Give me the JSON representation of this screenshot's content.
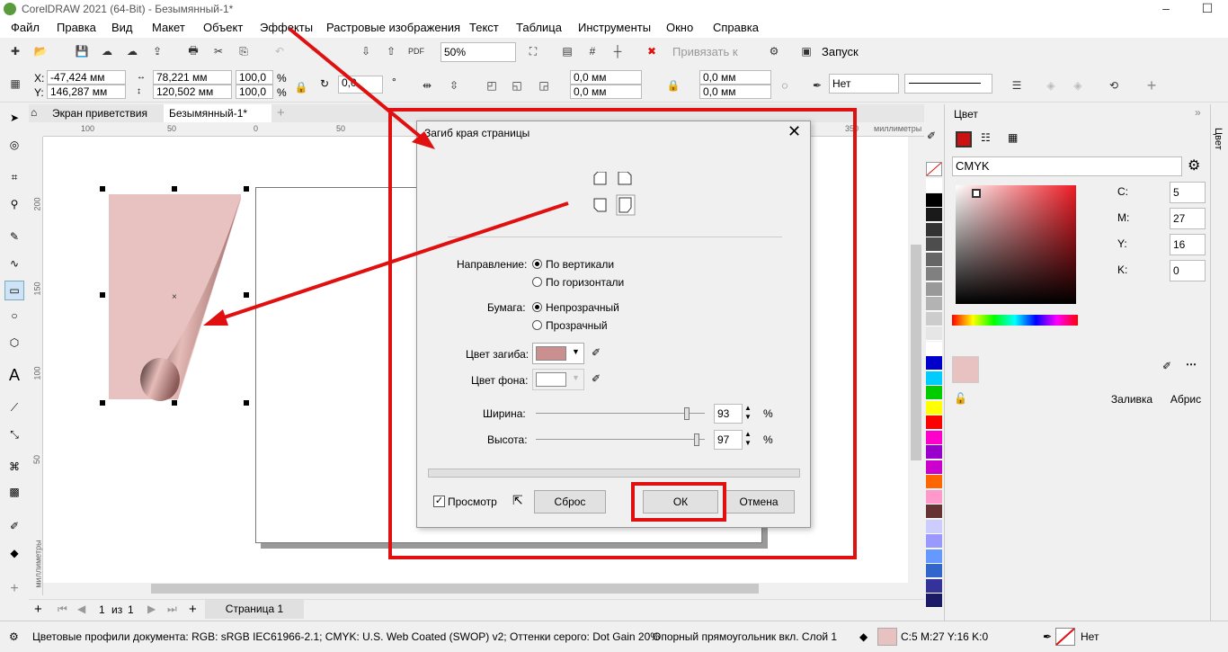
{
  "app": {
    "title": "CorelDRAW 2021 (64-Bit) - Безымянный-1*"
  },
  "menu": [
    "Файл",
    "Правка",
    "Вид",
    "Макет",
    "Объект",
    "Эффекты",
    "Растровые изображения",
    "Текст",
    "Таблица",
    "Инструменты",
    "Окно",
    "Справка"
  ],
  "toolbar": {
    "zoom": "50%",
    "snap_label": "Привязать к",
    "launch_label": "Запуск"
  },
  "props": {
    "x": "-47,424 мм",
    "y": "146,287 мм",
    "w": "78,221 мм",
    "h": "120,502 мм",
    "sx": "100,0",
    "sy": "100,0",
    "pct": "%",
    "rotation": "0,0",
    "deg": "°",
    "r1": "0,0 мм",
    "r2": "0,0 мм",
    "r3": "0,0 мм",
    "r4": "0,0 мм",
    "outline": "Нет"
  },
  "tabs": {
    "welcome": "Экран приветствия",
    "doc": "Безымянный-1*"
  },
  "ruler": {
    "h": [
      "100",
      "50",
      "0",
      "50",
      "350"
    ],
    "unit": "миллиметры",
    "v": [
      "200",
      "150",
      "100",
      "50"
    ],
    "vunit": "миллиметры"
  },
  "pages": {
    "current": "1",
    "of": "из",
    "total": "1",
    "page_tab": "Страница 1"
  },
  "dialog": {
    "title": "Загиб края страницы",
    "direction_label": "Направление:",
    "dir_vertical": "По вертикали",
    "dir_horizontal": "По горизонтали",
    "paper_label": "Бумага:",
    "paper_opaque": "Непрозрачный",
    "paper_transparent": "Прозрачный",
    "curl_color_label": "Цвет загиба:",
    "bg_color_label": "Цвет фона:",
    "width_label": "Ширина:",
    "width_value": "93",
    "height_label": "Высота:",
    "height_value": "97",
    "pct": "%",
    "preview_label": "Просмотр",
    "reset_label": "Сброс",
    "ok_label": "ОК",
    "cancel_label": "Отмена",
    "width_frac": 0.93,
    "height_frac": 0.97,
    "curl_color": "#c9908f",
    "bg_color": "#ffffff"
  },
  "docker": {
    "title": "Цвет",
    "model": "CMYK",
    "c_label": "C:",
    "c": "5",
    "m_label": "M:",
    "m": "27",
    "y_label": "Y:",
    "y": "16",
    "k_label": "K:",
    "k": "0",
    "fill_label": "Заливка",
    "outline_label": "Абрис",
    "side_tab": "Цвет",
    "current_color": "#e8c2c1"
  },
  "status": {
    "profiles": "Цветовые профили документа: RGB: sRGB IEC61966-2.1; CMYK: U.S. Web Coated (SWOP) v2; Оттенки серого: Dot Gain 20%",
    "object": "Опорный прямоугольник вкл. Слой 1",
    "fill": "C:5 M:27 Y:16 K:0",
    "outline": "Нет"
  },
  "colors": {
    "accent_red": "#e01010",
    "shape_fill": "#e8c2c1"
  },
  "palette": [
    "#ffffff",
    "#000000",
    "#1a1a1a",
    "#333333",
    "#4d4d4d",
    "#666666",
    "#808080",
    "#999999",
    "#b3b3b3",
    "#cccccc",
    "#e6e6e6",
    "#ffffff",
    "#0000cc",
    "#00ccff",
    "#00cc00",
    "#ffff00",
    "#ff0000",
    "#ff00cc",
    "#9900cc",
    "#cc00cc",
    "#ff6600",
    "#ff99cc",
    "#663333",
    "#ccccff",
    "#9999ff",
    "#6699ff",
    "#3366cc",
    "#333399",
    "#1a1a66"
  ]
}
